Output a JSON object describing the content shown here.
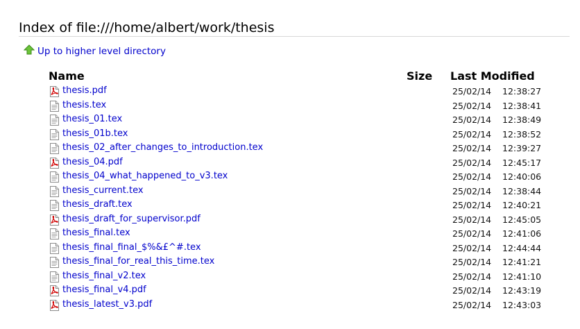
{
  "page": {
    "title": "Index of file:///home/albert/work/thesis",
    "up_link_label": "Up to higher level directory"
  },
  "table": {
    "headers": {
      "name": "Name",
      "size": "Size",
      "last_modified": "Last Modified"
    },
    "rows": [
      {
        "name": "thesis.pdf",
        "type": "pdf",
        "size": "",
        "date": "25/02/14",
        "time": "12:38:27"
      },
      {
        "name": "thesis.tex",
        "type": "tex",
        "size": "",
        "date": "25/02/14",
        "time": "12:38:41"
      },
      {
        "name": "thesis_01.tex",
        "type": "tex",
        "size": "",
        "date": "25/02/14",
        "time": "12:38:49"
      },
      {
        "name": "thesis_01b.tex",
        "type": "tex",
        "size": "",
        "date": "25/02/14",
        "time": "12:38:52"
      },
      {
        "name": "thesis_02_after_changes_to_introduction.tex",
        "type": "tex",
        "size": "",
        "date": "25/02/14",
        "time": "12:39:27"
      },
      {
        "name": "thesis_04.pdf",
        "type": "pdf",
        "size": "",
        "date": "25/02/14",
        "time": "12:45:17"
      },
      {
        "name": "thesis_04_what_happened_to_v3.tex",
        "type": "tex",
        "size": "",
        "date": "25/02/14",
        "time": "12:40:06"
      },
      {
        "name": "thesis_current.tex",
        "type": "tex",
        "size": "",
        "date": "25/02/14",
        "time": "12:38:44"
      },
      {
        "name": "thesis_draft.tex",
        "type": "tex",
        "size": "",
        "date": "25/02/14",
        "time": "12:40:21"
      },
      {
        "name": "thesis_draft_for_supervisor.pdf",
        "type": "pdf",
        "size": "",
        "date": "25/02/14",
        "time": "12:45:05"
      },
      {
        "name": "thesis_final.tex",
        "type": "tex",
        "size": "",
        "date": "25/02/14",
        "time": "12:41:06"
      },
      {
        "name": "thesis_final_final_$%&£^#.tex",
        "type": "tex",
        "size": "",
        "date": "25/02/14",
        "time": "12:44:44"
      },
      {
        "name": "thesis_final_for_real_this_time.tex",
        "type": "tex",
        "size": "",
        "date": "25/02/14",
        "time": "12:41:21"
      },
      {
        "name": "thesis_final_v2.tex",
        "type": "tex",
        "size": "",
        "date": "25/02/14",
        "time": "12:41:10"
      },
      {
        "name": "thesis_final_v4.pdf",
        "type": "pdf",
        "size": "",
        "date": "25/02/14",
        "time": "12:43:19"
      },
      {
        "name": "thesis_latest_v3.pdf",
        "type": "pdf",
        "size": "",
        "date": "25/02/14",
        "time": "12:43:03"
      }
    ]
  },
  "icons": {
    "up": "up-arrow-icon",
    "pdf": "pdf-file-icon",
    "tex": "text-file-icon"
  },
  "colors": {
    "link": "#0000cc",
    "up_arrow": "#5cb82c",
    "pdf_red": "#d10000"
  }
}
